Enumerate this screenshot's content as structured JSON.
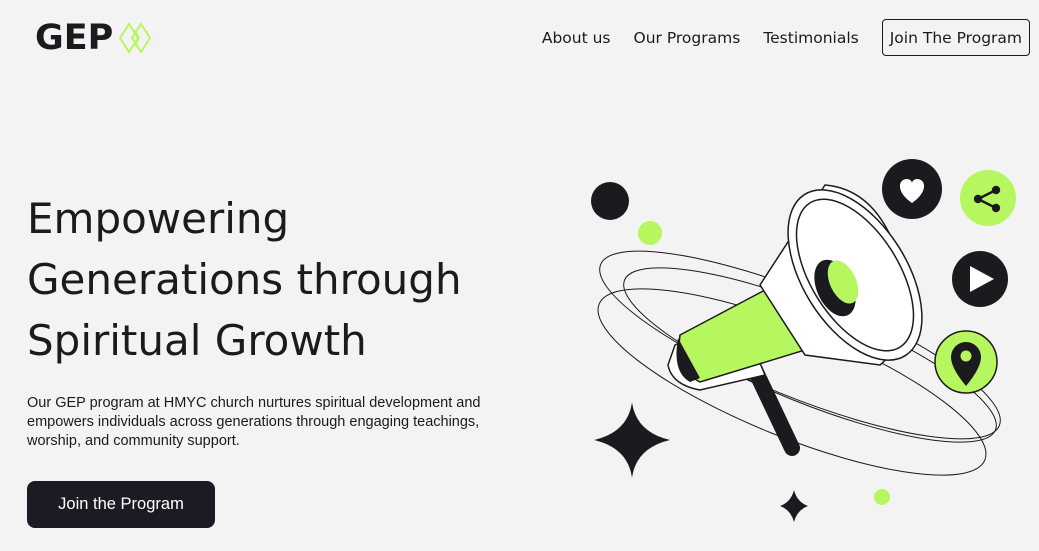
{
  "brand": {
    "name": "GEP",
    "accent": "#b6f760",
    "dark": "#1b1b1f"
  },
  "nav": {
    "items": [
      "About us",
      "Our Programs",
      "Testimonials"
    ],
    "cta": "Join The Program"
  },
  "hero": {
    "title_lines": [
      "Empowering",
      "Generations through",
      "Spiritual Growth"
    ],
    "description": "Our GEP program at HMYC church nurtures spiritual development and empowers individuals across generations through engaging teachings, worship, and community support.",
    "button": "Join the Program"
  },
  "illustration": {
    "icons": [
      "megaphone-icon",
      "heart-icon",
      "share-icon",
      "play-icon",
      "location-pin-icon",
      "sparkle-icon"
    ]
  }
}
